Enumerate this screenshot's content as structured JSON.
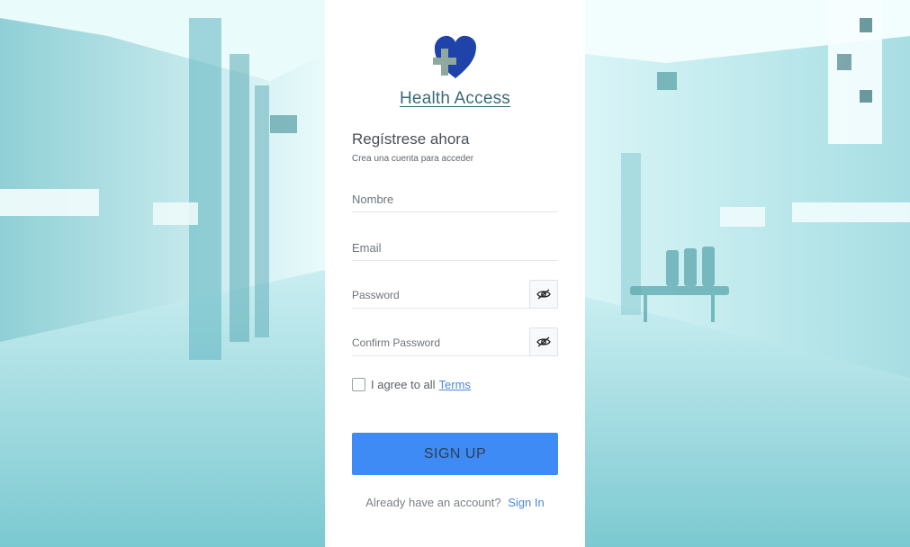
{
  "brand": {
    "name": "Health Access",
    "logo_icon": "heart-plus-icon",
    "colors": {
      "heart": "#1f43a8",
      "cross": "#8fa99f"
    }
  },
  "form": {
    "heading": "Regístrese ahora",
    "subheading": "Crea una cuenta para acceder",
    "fields": {
      "nombre": {
        "placeholder": "Nombre",
        "value": ""
      },
      "email": {
        "placeholder": "Email",
        "value": ""
      },
      "password": {
        "placeholder": "Password",
        "value": "",
        "toggle_icon": "eye-slash-icon"
      },
      "confirm_password": {
        "placeholder": "Confirm Password",
        "value": "",
        "toggle_icon": "eye-slash-icon"
      }
    },
    "terms": {
      "checked": false,
      "text": "I agree to all",
      "link": "Terms"
    },
    "submit_label": "SIGN UP",
    "footer": {
      "text": "Already have an account?",
      "link": "Sign In"
    }
  },
  "theme": {
    "accent": "#3e8bf5",
    "link": "#4a89dc"
  },
  "background": {
    "description_icon": "hospital-corridor-image"
  }
}
